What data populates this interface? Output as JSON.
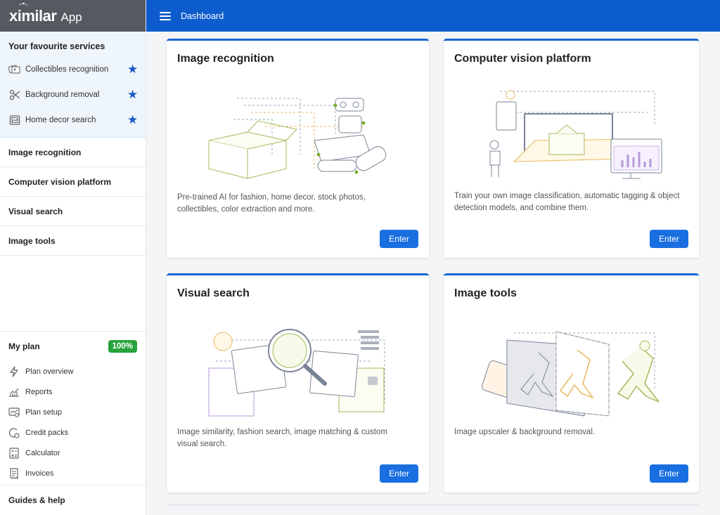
{
  "brand": {
    "logo": "ximilar",
    "app": "App"
  },
  "topbar": {
    "title": "Dashboard"
  },
  "favourites": {
    "title": "Your favourite services",
    "items": [
      {
        "label": "Collectibles recognition",
        "icon": "cards-icon"
      },
      {
        "label": "Background removal",
        "icon": "scissors-icon"
      },
      {
        "label": "Home decor search",
        "icon": "picture-frame-icon"
      }
    ]
  },
  "nav": {
    "items": [
      "Image recognition",
      "Computer vision platform",
      "Visual search",
      "Image tools"
    ]
  },
  "plan": {
    "title": "My plan",
    "badge": "100%",
    "items": [
      {
        "label": "Plan overview",
        "icon": "bolt-icon"
      },
      {
        "label": "Reports",
        "icon": "chart-icon"
      },
      {
        "label": "Plan setup",
        "icon": "plan-setup-icon"
      },
      {
        "label": "Credit packs",
        "icon": "credit-icon"
      },
      {
        "label": "Calculator",
        "icon": "calculator-icon"
      },
      {
        "label": "Invoices",
        "icon": "invoice-icon"
      }
    ]
  },
  "guides": "Guides & help",
  "cards": [
    {
      "title": "Image recognition",
      "desc": "Pre-trained AI for fashion, home decor, stock photos, collectibles, color extraction and more.",
      "button": "Enter"
    },
    {
      "title": "Computer vision platform",
      "desc": "Train your own image classification, automatic tagging & object detection models, and combine them.",
      "button": "Enter"
    },
    {
      "title": "Visual search",
      "desc": "Image similarity, fashion search, image matching & custom visual search.",
      "button": "Enter"
    },
    {
      "title": "Image tools",
      "desc": "Image upscaler & background removal.",
      "button": "Enter"
    }
  ],
  "colors": {
    "accent": "#0d5ccd",
    "star": "#1a56c8",
    "badge": "#27a33b",
    "button": "#1a6fe0"
  }
}
